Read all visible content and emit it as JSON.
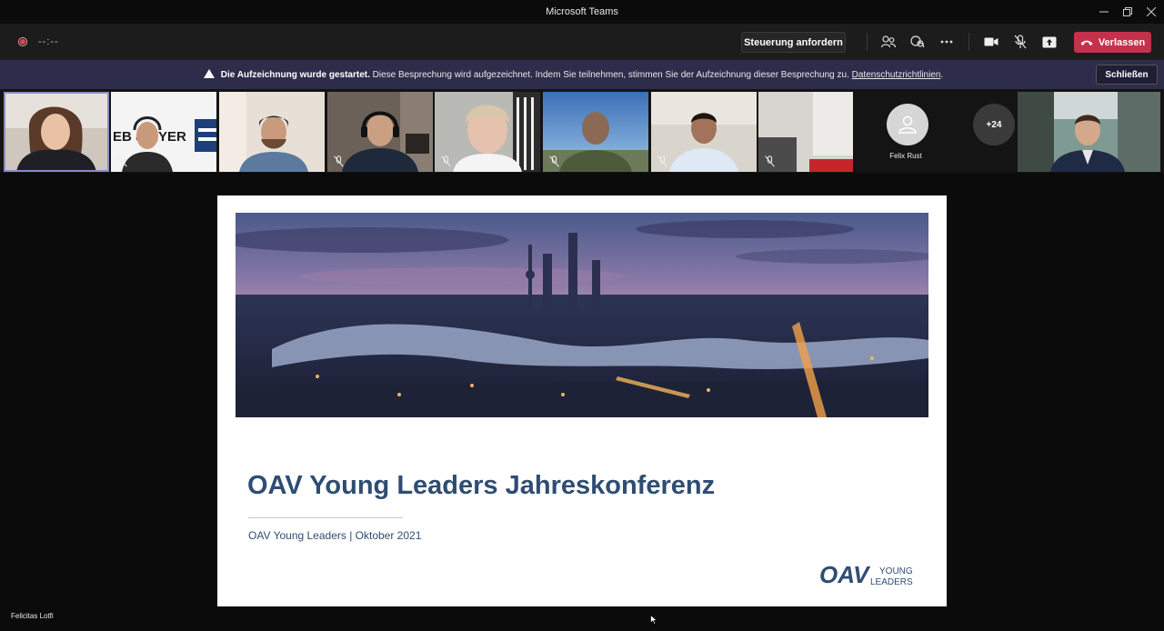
{
  "window": {
    "title": "Microsoft Teams"
  },
  "toolbar": {
    "timer": "--:--",
    "request_control_label": "Steuerung anfordern",
    "leave_label": "Verlassen",
    "icons": [
      "participants-icon",
      "chat-icon",
      "more-icon",
      "camera-icon",
      "mic-off-icon",
      "share-icon",
      "phone-icon"
    ],
    "leave_color": "#c4314b"
  },
  "banner": {
    "bold": "Die Aufzeichnung wurde gestartet.",
    "text": "Diese Besprechung wird aufgezeichnet. Indem Sie teilnehmen, stimmen Sie der Aufzeichnung dieser Besprechung zu.",
    "link": "Datenschutzrichtlinien",
    "link_suffix": ".",
    "close_label": "Schließen",
    "bg_color": "#2d2c4a"
  },
  "participants": {
    "avatar_name": "Felix Rust",
    "overflow_count": "+24",
    "tile_logo_text": "EB & EYER"
  },
  "slide": {
    "title": "OAV Young Leaders Jahreskonferenz",
    "subtitle": "OAV Young Leaders  |  Oktober 2021",
    "logo_mark": "OAV",
    "logo_line1": "YOUNG",
    "logo_line2": "LEADERS",
    "accent_color": "#2f4d73"
  },
  "speaker": {
    "name": "Felicitas Lotfi"
  }
}
